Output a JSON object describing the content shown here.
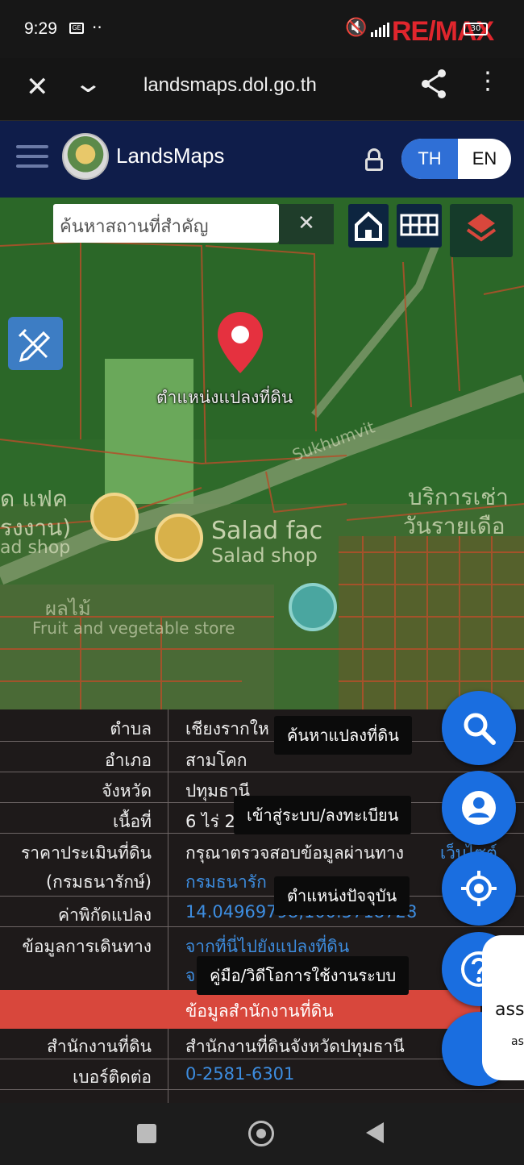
{
  "status_bar": {
    "time": "9:29",
    "sim_label": "GE",
    "overflow": "··",
    "overlay_brand": "RE/MAX",
    "battery_text": "30",
    "colors": {
      "brand": "#e0262d"
    }
  },
  "browser": {
    "url": "landsmaps.dol.go.th",
    "close_icon": "close-icon",
    "collapse_icon": "chevron-down-icon",
    "share_icon": "share-icon",
    "menu_icon": "more-vertical-icon"
  },
  "app_header": {
    "brand": "LandsMaps",
    "lang_th": "TH",
    "lang_en": "EN",
    "colors": {
      "header_bg": "#0f1d4a",
      "accent": "#2f6fd6",
      "search_btn": "#e0323a"
    }
  },
  "map": {
    "search_placeholder": "ค้นหาสถานที่สำคัญ",
    "clear_label": "✕",
    "parcel_label": "ตำแหน่งแปลงที่ดิน",
    "labels": {
      "salad_th": "Salad fac",
      "salad_en": "Salad shop",
      "salad_left_th": "ัด แฟค",
      "salad_left_th2": "รงงาน)",
      "salad_left_en": "ad shop",
      "fruit_th": "ผลไม้",
      "fruit_en": "Fruit and vegetable store",
      "service_th": "บริการเช่า",
      "service_th2": "วันรายเดือ",
      "road": "Sukhumvit"
    }
  },
  "info": {
    "rows": [
      {
        "key": "ตำบล",
        "value": "เชียงรากให"
      },
      {
        "key": "อำเภอ",
        "value": "สามโคก"
      },
      {
        "key": "จังหวัด",
        "value": "ปทุมธานี"
      },
      {
        "key": "เนื้อที่",
        "value": "6 ไร่ 2"
      },
      {
        "key": "ราคาประเมินที่ดิน",
        "value": "กรุณาตรวจสอบข้อมูลผ่านทาง",
        "link": "เว็บไซต์"
      },
      {
        "key": "(กรมธนารักษ์)",
        "value": "กรมธนารัก"
      },
      {
        "key": "ค่าพิกัดแปลง",
        "value": "14.04969798,100.5718728"
      },
      {
        "key": "ข้อมูลการเดินทาง",
        "value": "จากที่นี่ไปยังแปลงที่ดิน"
      },
      {
        "key": "",
        "value": "จ"
      }
    ],
    "office_header": "ข้อมูลสำนักงานที่ดิน",
    "office_rows": [
      {
        "key": "สำนักงานที่ดิน",
        "value": "สำนักงานที่ดินจังหวัดปทุมธานี"
      },
      {
        "key": "เบอร์ติดต่อ",
        "value": "0-2581-6301"
      }
    ]
  },
  "tooltips": {
    "search_parcel": "ค้นหาแปลงที่ดิน",
    "login": "เข้าสู่ระบบ/ลงทะเบียน",
    "current_location": "ตำแหน่งปัจจุบัน",
    "manual": "คู่มือ/วิดีโอการใช้งานระบบ"
  },
  "side_panel": {
    "text1": "ass",
    "text2": "as"
  }
}
